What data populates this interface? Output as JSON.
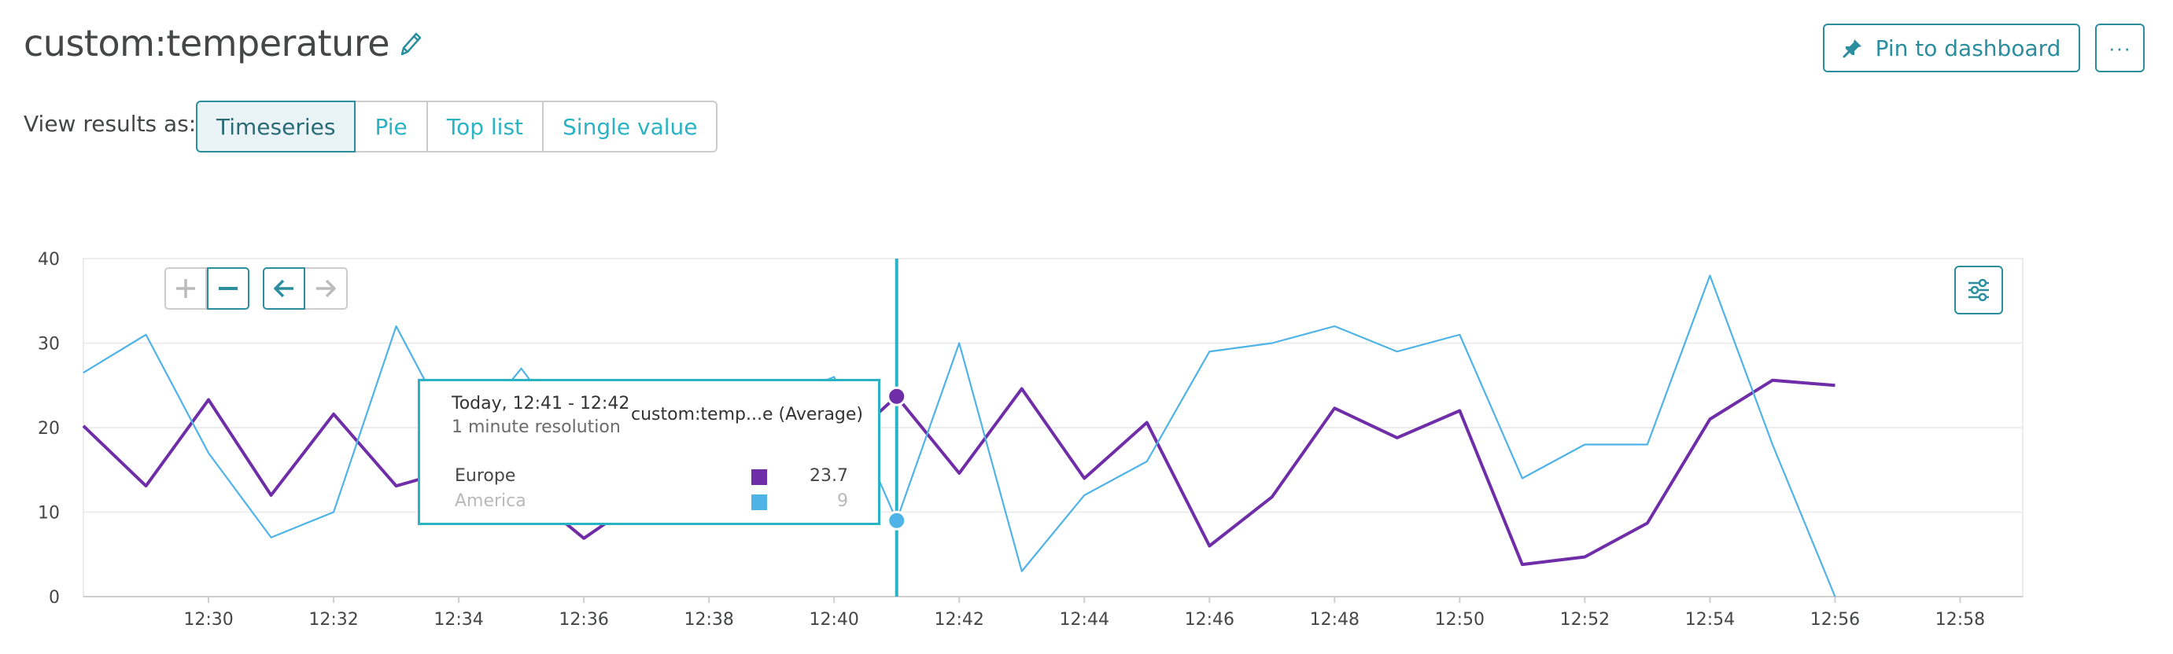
{
  "header": {
    "title": "custom:temperature",
    "pin_label": "Pin to dashboard",
    "more_label": "···"
  },
  "view": {
    "label": "View results as:",
    "options": [
      "Timeseries",
      "Pie",
      "Top list",
      "Single value"
    ],
    "selected": "Timeseries"
  },
  "tooltip": {
    "time": "Today, 12:41 - 12:42",
    "resolution": "1 minute resolution",
    "metric": "custom:temp...e (Average)",
    "rows": [
      {
        "name": "Europe",
        "value": "23.7",
        "color": "#6f2da8"
      },
      {
        "name": "America",
        "value": "9",
        "color": "#4fb3e8"
      }
    ]
  },
  "colors": {
    "accent": "#2a8e9e",
    "europe": "#6f2da8",
    "america": "#4fb3e8",
    "cursor": "#2ab3c4"
  },
  "chart_data": {
    "type": "line",
    "y_ticks": [
      "0",
      "10",
      "20",
      "30",
      "40"
    ],
    "x_ticks": [
      "12:30",
      "12:32",
      "12:34",
      "12:36",
      "12:38",
      "12:40",
      "12:42",
      "12:44",
      "12:46",
      "12:48",
      "12:50",
      "12:52",
      "12:54",
      "12:56",
      "12:58"
    ],
    "ylim": [
      0,
      40
    ],
    "xlim": [
      "12:28",
      "12:59"
    ],
    "grid": true,
    "cursor_x": "12:41",
    "series": [
      {
        "name": "Europe",
        "color": "#6f2da8",
        "x": [
          "12:28",
          "12:29",
          "12:30",
          "12:31",
          "12:32",
          "12:33",
          "12:34",
          "12:35",
          "12:36",
          "12:37",
          "12:38",
          "12:39",
          "12:40",
          "12:41",
          "12:42",
          "12:43",
          "12:44",
          "12:45",
          "12:46",
          "12:47",
          "12:48",
          "12:49",
          "12:50",
          "12:51",
          "12:52",
          "12:53",
          "12:54",
          "12:55",
          "12:56"
        ],
        "values": [
          20.2,
          13.1,
          23.3,
          12.0,
          21.6,
          13.1,
          15.2,
          13.0,
          6.9,
          12.0,
          13.0,
          14.0,
          17.0,
          23.7,
          14.6,
          24.6,
          14.0,
          20.6,
          6.0,
          11.8,
          22.3,
          18.8,
          22.0,
          3.8,
          4.7,
          8.7,
          21.0,
          25.6,
          25.0
        ]
      },
      {
        "name": "America",
        "color": "#4fb3e8",
        "x": [
          "12:28",
          "12:29",
          "12:30",
          "12:31",
          "12:32",
          "12:33",
          "12:34",
          "12:35",
          "12:36",
          "12:37",
          "12:38",
          "12:39",
          "12:40",
          "12:41",
          "12:42",
          "12:43",
          "12:44",
          "12:45",
          "12:46",
          "12:47",
          "12:48",
          "12:49",
          "12:50",
          "12:51",
          "12:52",
          "12:53",
          "12:54",
          "12:55",
          "12:56"
        ],
        "values": [
          26.5,
          31.0,
          17.0,
          7.0,
          10.0,
          32.0,
          18.0,
          27.0,
          17.0,
          20.0,
          19.0,
          23.0,
          26.0,
          9.0,
          30.0,
          3.0,
          12.0,
          16.0,
          29.0,
          30.0,
          32.0,
          29.0,
          31.0,
          14.0,
          18.0,
          18.0,
          38.0,
          18.0,
          0.0
        ]
      }
    ]
  }
}
